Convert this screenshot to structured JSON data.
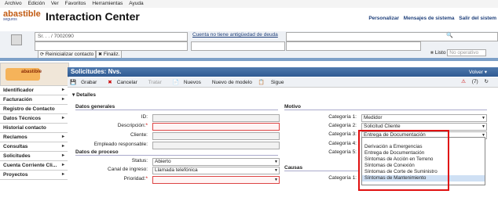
{
  "menu": [
    "Archivo",
    "Edición",
    "Ver",
    "Favoritos",
    "Herramientas",
    "Ayuda"
  ],
  "header": {
    "logo": "abastible",
    "logo_sub": "seguros",
    "title": "Interaction Center",
    "links": [
      "Personalizar",
      "Mensajes de sistema",
      "Salir del sistem"
    ]
  },
  "interaction": {
    "customer_field": "Sr. . . / 7002090",
    "notice": "Cuenta no tiene antigüedad de deuda",
    "reset_button": "Reinicializar contacto",
    "finish_button": "Finaliz.",
    "status_label": "Listo",
    "status_placeholder": "No operativo"
  },
  "nav": {
    "logo": "abastible",
    "items": [
      "Identificador",
      "Facturación",
      "Registro de Contacto",
      "Datos Técnicos",
      "Historial contacto",
      "Reclamos",
      "Consultas",
      "Solicitudes",
      "Cuenta Corriente Cli...",
      "Proyectos"
    ]
  },
  "page": {
    "title": "Solicitudes: Nvs.",
    "back": "Volver",
    "alerts": "(7)",
    "toolbar": [
      "Grabar",
      "Cancelar",
      "Tratar",
      "Nuevos",
      "Nuevo de modelo",
      "Sigue"
    ]
  },
  "details": {
    "section": "Detalles",
    "general_title": "Datos generales",
    "labels": [
      "ID:",
      "Descripción:",
      "Cliente:",
      "Empleado responsable:"
    ],
    "process_title": "Datos de proceso",
    "status_label": "Status:",
    "status_value": "Abierto",
    "channel_label": "Canal de ingreso:",
    "channel_value": "Llamada telefónica",
    "priority_label": "Prioridad:"
  },
  "motivo": {
    "title": "Motivo",
    "cat1_label": "Categoría 1:",
    "cat1_value": "Medidor",
    "cat2_label": "Categoría 2:",
    "cat2_value": "Solicitud Cliente",
    "cat3_label": "Categoría 3:",
    "cat3_value": "Entrega de Documentación",
    "cat4_label": "Categoría 4:",
    "cat5_label": "Categoría 5:",
    "causas_title": "Causas",
    "causas_cat_label": "Categoría 1:"
  },
  "dropdown_options": [
    "",
    "Derivación a Emergencias",
    "Entrega de Documentación",
    "Síntomas de Acción en Terreno",
    "Síntomas de Conexión",
    "Síntomas de Corte de Suministro",
    "Síntomas de Mantenimiento"
  ],
  "colors": {
    "accent_blue": "#2f5a92",
    "highlight_red": "#e01010",
    "brand_orange": "#c25b12"
  }
}
